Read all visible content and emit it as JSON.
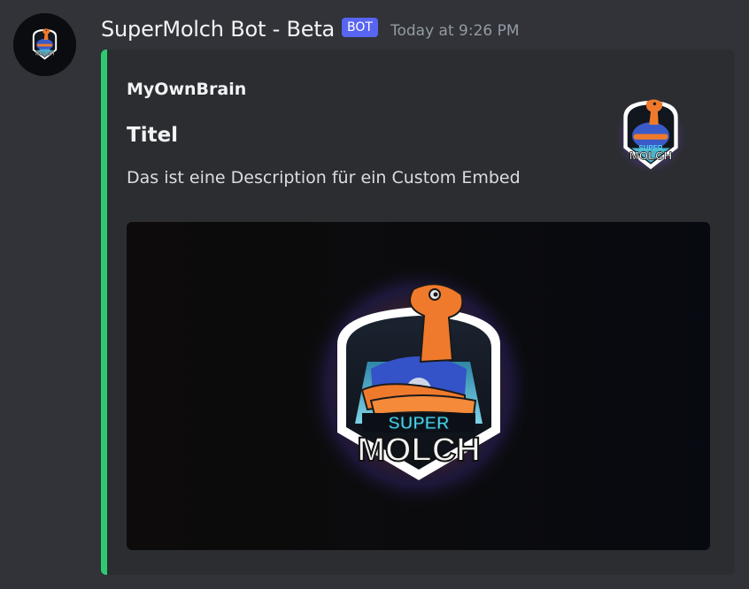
{
  "message": {
    "author": {
      "name": "SuperMolch Bot - Beta",
      "bot_tag": "BOT",
      "avatar_icon": "supermolch-logo-icon"
    },
    "timestamp": "Today at 9:26 PM",
    "embed": {
      "color": "#2ecc71",
      "author_name": "MyOwnBrain",
      "title": "Titel",
      "description": "Das ist eine Description für ein Custom Embed",
      "thumbnail_icon": "supermolch-logo-icon",
      "image": {
        "icon": "supermolch-logo-icon",
        "logo_text_top": "SUPER",
        "logo_text_bottom": "MOLCH"
      }
    }
  }
}
